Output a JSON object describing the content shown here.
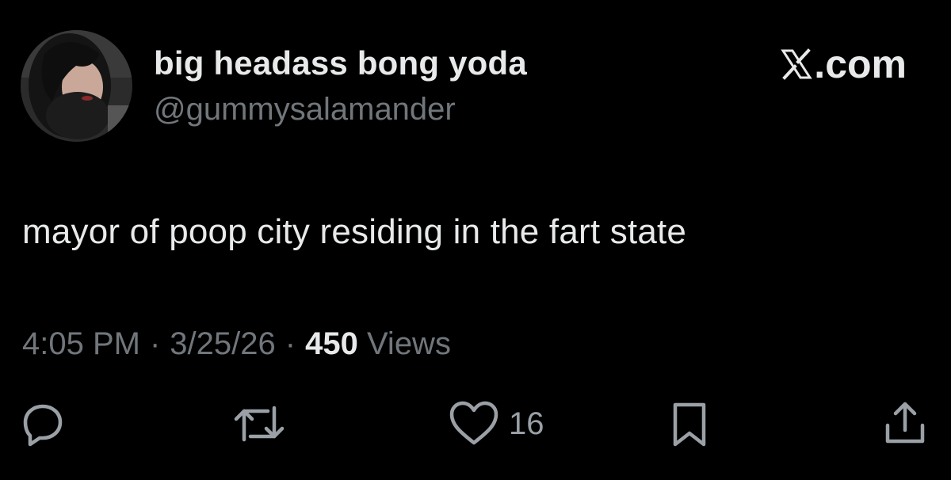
{
  "author": {
    "display_name": "big headass bong yoda",
    "handle": "@gummysalamander"
  },
  "brand": {
    "label": ".com",
    "icon": "x-logo-icon"
  },
  "tweet": {
    "text": "mayor of poop city residing in the fart state",
    "time": "4:05 PM",
    "date": "3/25/26",
    "separator": "·",
    "views_count": "450",
    "views_label": "Views"
  },
  "actions": {
    "reply": {
      "icon": "reply-icon"
    },
    "repost": {
      "icon": "repost-icon"
    },
    "like": {
      "icon": "heart-icon",
      "count": "16"
    },
    "bookmark": {
      "icon": "bookmark-icon"
    },
    "share": {
      "icon": "share-icon"
    }
  },
  "colors": {
    "background": "#000000",
    "primary_text": "#e7e9ea",
    "secondary_text": "#71767b",
    "icon": "#9aa0a6"
  }
}
